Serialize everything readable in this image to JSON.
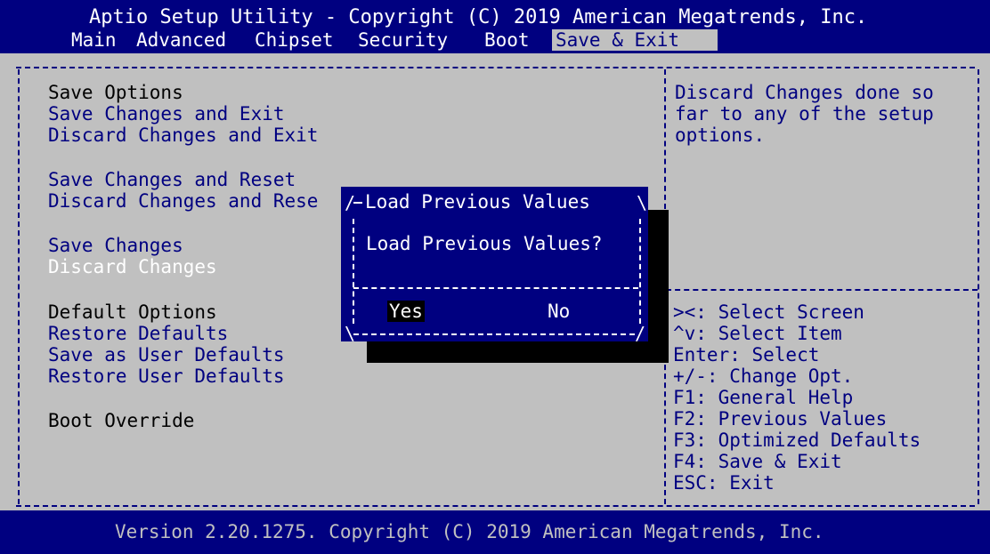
{
  "header": {
    "title": "Aptio Setup Utility - Copyright (C) 2019 American Megatrends, Inc.",
    "tabs": [
      {
        "label": "Main"
      },
      {
        "label": "Advanced"
      },
      {
        "label": "Chipset"
      },
      {
        "label": "Security"
      },
      {
        "label": "Boot"
      },
      {
        "label": "Save & Exit",
        "active": true
      }
    ]
  },
  "menu": {
    "save_options_heading": "Save Options",
    "items_save": [
      "Save Changes and Exit",
      "Discard Changes and Exit",
      "Save Changes and Reset",
      "Discard Changes and Rese",
      "Save Changes",
      "Discard Changes"
    ],
    "selected_item": "Discard Changes",
    "default_options_heading": "Default Options",
    "items_default": [
      "Restore Defaults",
      "Save as User Defaults",
      "Restore User Defaults"
    ],
    "boot_override_heading": "Boot Override"
  },
  "help": {
    "description_lines": [
      "Discard Changes done so",
      "far to any of the setup",
      "options."
    ],
    "keys": [
      "><: Select Screen",
      "^v: Select Item",
      "Enter: Select",
      "+/-: Change Opt.",
      "F1: General Help",
      "F2: Previous Values",
      "F3: Optimized Defaults",
      "F4: Save & Exit",
      "ESC: Exit"
    ]
  },
  "dialog": {
    "title": "Load Previous Values",
    "prompt": "Load Previous Values?",
    "yes_label": "Yes",
    "no_label": "No"
  },
  "footer": {
    "text": "Version 2.20.1275. Copyright (C) 2019 American Megatrends, Inc."
  },
  "colors": {
    "background": "#c0c0c0",
    "bar": "#000080",
    "text": "#000080",
    "heading": "#000000",
    "highlight": "#ffffff"
  }
}
